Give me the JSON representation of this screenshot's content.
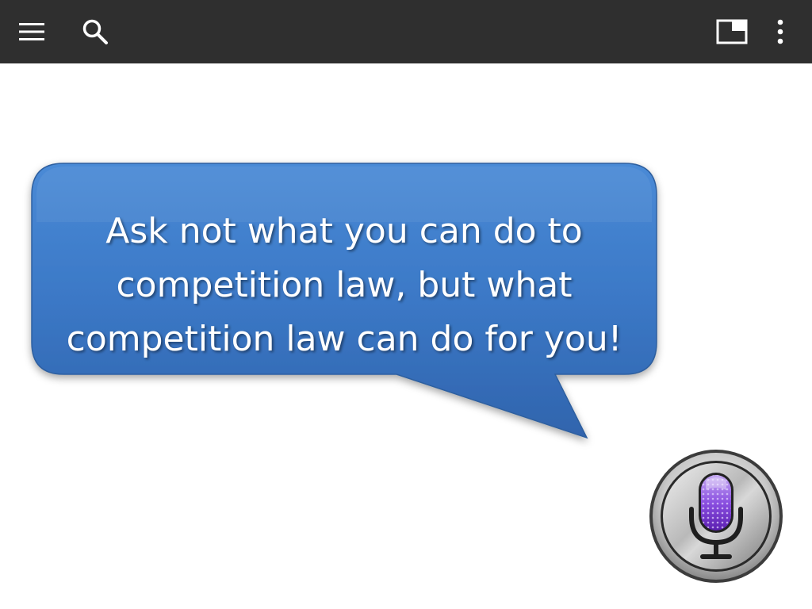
{
  "toolbar": {
    "background": "#2f2f2f",
    "icons": {
      "menu": "menu-icon",
      "search": "search-icon",
      "window": "window-icon",
      "more": "more-vertical-icon"
    }
  },
  "slide": {
    "quote_lines": [
      "Ask not what you can do to",
      "competition law, but what",
      "competition law can do for you!"
    ],
    "bubble_color": "#3b78c6",
    "mic_icon": "siri-microphone-icon"
  }
}
